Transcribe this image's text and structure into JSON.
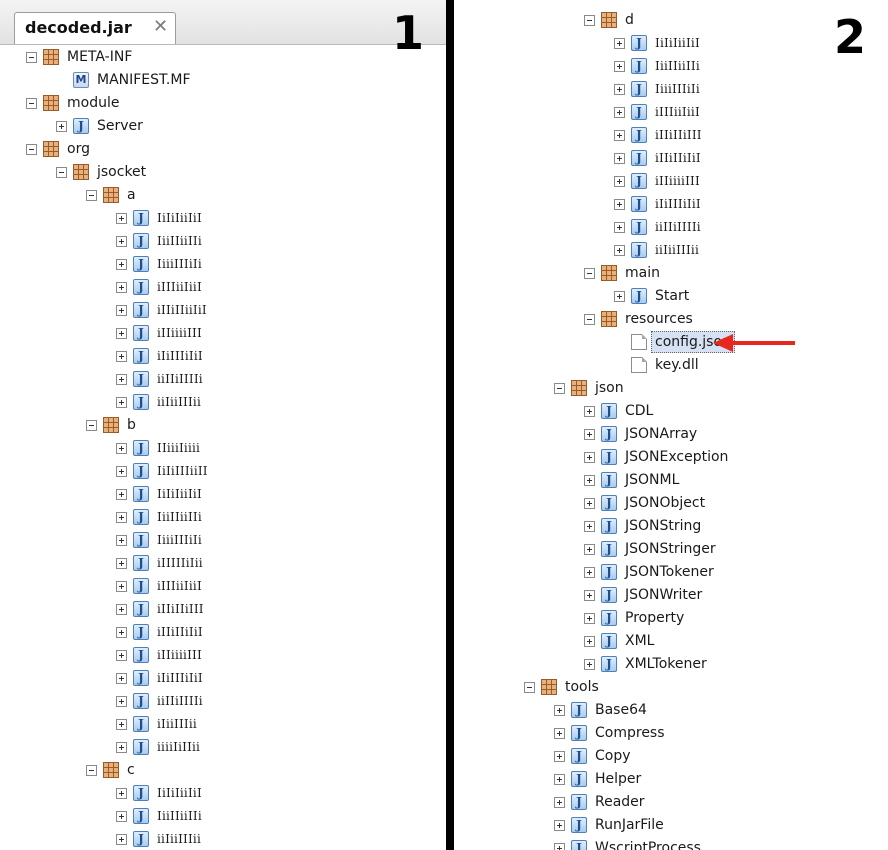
{
  "panel1": {
    "tab_label": "decoded.jar",
    "close_glyph": "✕",
    "number": "1",
    "rows": [
      {
        "indent": 1,
        "toggle": "minus",
        "icon": "package",
        "label": "META-INF"
      },
      {
        "indent": 2,
        "toggle": "none",
        "icon": "manifest",
        "label": "MANIFEST.MF"
      },
      {
        "indent": 1,
        "toggle": "minus",
        "icon": "package",
        "label": "module"
      },
      {
        "indent": 2,
        "toggle": "plus",
        "icon": "class",
        "label": "Server"
      },
      {
        "indent": 1,
        "toggle": "minus",
        "icon": "package",
        "label": "org"
      },
      {
        "indent": 2,
        "toggle": "minus",
        "icon": "package",
        "label": "jsocket"
      },
      {
        "indent": 3,
        "toggle": "minus",
        "icon": "package",
        "label": "a"
      },
      {
        "indent": 4,
        "toggle": "plus",
        "icon": "class",
        "label": "IiIiIiiIiI",
        "obf": true
      },
      {
        "indent": 4,
        "toggle": "plus",
        "icon": "class",
        "label": "IiiIIiiIIi",
        "obf": true
      },
      {
        "indent": 4,
        "toggle": "plus",
        "icon": "class",
        "label": "IiiiIIIiIi",
        "obf": true
      },
      {
        "indent": 4,
        "toggle": "plus",
        "icon": "class",
        "label": "iIIIiiIiiI",
        "obf": true
      },
      {
        "indent": 4,
        "toggle": "plus",
        "icon": "class",
        "label": "iIIiIIiiIiI",
        "obf": true
      },
      {
        "indent": 4,
        "toggle": "plus",
        "icon": "class",
        "label": "iIIiiiiIII",
        "obf": true
      },
      {
        "indent": 4,
        "toggle": "plus",
        "icon": "class",
        "label": "iIiIIIiIiI",
        "obf": true
      },
      {
        "indent": 4,
        "toggle": "plus",
        "icon": "class",
        "label": "iiIIiIIIIi",
        "obf": true
      },
      {
        "indent": 4,
        "toggle": "plus",
        "icon": "class",
        "label": "iiIiiIIIii",
        "obf": true
      },
      {
        "indent": 3,
        "toggle": "minus",
        "icon": "package",
        "label": "b"
      },
      {
        "indent": 4,
        "toggle": "plus",
        "icon": "class",
        "label": "IIiiiIiiii",
        "obf": true
      },
      {
        "indent": 4,
        "toggle": "plus",
        "icon": "class",
        "label": "IiIiIIIiiII",
        "obf": true
      },
      {
        "indent": 4,
        "toggle": "plus",
        "icon": "class",
        "label": "IiIiIiiIiI",
        "obf": true
      },
      {
        "indent": 4,
        "toggle": "plus",
        "icon": "class",
        "label": "IiiIIiiIIi",
        "obf": true
      },
      {
        "indent": 4,
        "toggle": "plus",
        "icon": "class",
        "label": "IiiiIIIiIi",
        "obf": true
      },
      {
        "indent": 4,
        "toggle": "plus",
        "icon": "class",
        "label": "iIIIIIiIii",
        "obf": true
      },
      {
        "indent": 4,
        "toggle": "plus",
        "icon": "class",
        "label": "iIIIiiIiiI",
        "obf": true
      },
      {
        "indent": 4,
        "toggle": "plus",
        "icon": "class",
        "label": "iIIiIIiIII",
        "obf": true
      },
      {
        "indent": 4,
        "toggle": "plus",
        "icon": "class",
        "label": "iIIiIIiIiI",
        "obf": true
      },
      {
        "indent": 4,
        "toggle": "plus",
        "icon": "class",
        "label": "iIIiiiiIII",
        "obf": true
      },
      {
        "indent": 4,
        "toggle": "plus",
        "icon": "class",
        "label": "iIiIIIiIiI",
        "obf": true
      },
      {
        "indent": 4,
        "toggle": "plus",
        "icon": "class",
        "label": "iiIIiIIIIi",
        "obf": true
      },
      {
        "indent": 4,
        "toggle": "plus",
        "icon": "class",
        "label": "iIiiIIIii",
        "obf": true
      },
      {
        "indent": 4,
        "toggle": "plus",
        "icon": "class",
        "label": "iiiiIiIIii",
        "obf": true
      },
      {
        "indent": 3,
        "toggle": "minus",
        "icon": "package",
        "label": "c"
      },
      {
        "indent": 4,
        "toggle": "plus",
        "icon": "class",
        "label": "IiIiIiiIiI",
        "obf": true
      },
      {
        "indent": 4,
        "toggle": "plus",
        "icon": "class",
        "label": "IiiIIiiIIi",
        "obf": true
      },
      {
        "indent": 4,
        "toggle": "plus",
        "icon": "class",
        "label": "iiIiiIIIii",
        "obf": true
      }
    ]
  },
  "panel2": {
    "number": "2",
    "rows": [
      {
        "indent": 3,
        "toggle": "minus",
        "icon": "package",
        "label": "d"
      },
      {
        "indent": 4,
        "toggle": "plus",
        "icon": "class",
        "label": "IiIiIiiIiI",
        "obf": true
      },
      {
        "indent": 4,
        "toggle": "plus",
        "icon": "class",
        "label": "IiiIIiiIIi",
        "obf": true
      },
      {
        "indent": 4,
        "toggle": "plus",
        "icon": "class",
        "label": "IiiiIIIiIi",
        "obf": true
      },
      {
        "indent": 4,
        "toggle": "plus",
        "icon": "class",
        "label": "iIIIiiIiiI",
        "obf": true
      },
      {
        "indent": 4,
        "toggle": "plus",
        "icon": "class",
        "label": "iIIiIIiIII",
        "obf": true
      },
      {
        "indent": 4,
        "toggle": "plus",
        "icon": "class",
        "label": "iIIiIIiIiI",
        "obf": true
      },
      {
        "indent": 4,
        "toggle": "plus",
        "icon": "class",
        "label": "iIIiiiiIII",
        "obf": true
      },
      {
        "indent": 4,
        "toggle": "plus",
        "icon": "class",
        "label": "iIiIIIiIiI",
        "obf": true
      },
      {
        "indent": 4,
        "toggle": "plus",
        "icon": "class",
        "label": "iiIIiIIIIi",
        "obf": true
      },
      {
        "indent": 4,
        "toggle": "plus",
        "icon": "class",
        "label": "iiIiiIIIii",
        "obf": true
      },
      {
        "indent": 3,
        "toggle": "minus",
        "icon": "package",
        "label": "main"
      },
      {
        "indent": 4,
        "toggle": "plus",
        "icon": "class",
        "label": "Start"
      },
      {
        "indent": 3,
        "toggle": "minus",
        "icon": "package",
        "label": "resources"
      },
      {
        "indent": 4,
        "toggle": "none",
        "icon": "file",
        "label": "config.json",
        "selected": true
      },
      {
        "indent": 4,
        "toggle": "none",
        "icon": "file",
        "label": "key.dll"
      },
      {
        "indent": 2,
        "toggle": "minus",
        "icon": "package",
        "label": "json"
      },
      {
        "indent": 3,
        "toggle": "plus",
        "icon": "class",
        "label": "CDL"
      },
      {
        "indent": 3,
        "toggle": "plus",
        "icon": "class",
        "label": "JSONArray"
      },
      {
        "indent": 3,
        "toggle": "plus",
        "icon": "class",
        "label": "JSONException"
      },
      {
        "indent": 3,
        "toggle": "plus",
        "icon": "class",
        "label": "JSONML"
      },
      {
        "indent": 3,
        "toggle": "plus",
        "icon": "class",
        "label": "JSONObject"
      },
      {
        "indent": 3,
        "toggle": "plus",
        "icon": "class",
        "label": "JSONString"
      },
      {
        "indent": 3,
        "toggle": "plus",
        "icon": "class",
        "label": "JSONStringer"
      },
      {
        "indent": 3,
        "toggle": "plus",
        "icon": "class",
        "label": "JSONTokener"
      },
      {
        "indent": 3,
        "toggle": "plus",
        "icon": "class",
        "label": "JSONWriter"
      },
      {
        "indent": 3,
        "toggle": "plus",
        "icon": "class",
        "label": "Property"
      },
      {
        "indent": 3,
        "toggle": "plus",
        "icon": "class",
        "label": "XML"
      },
      {
        "indent": 3,
        "toggle": "plus",
        "icon": "class",
        "label": "XMLTokener"
      },
      {
        "indent": 1,
        "toggle": "minus",
        "icon": "package",
        "label": "tools"
      },
      {
        "indent": 2,
        "toggle": "plus",
        "icon": "class",
        "label": "Base64"
      },
      {
        "indent": 2,
        "toggle": "plus",
        "icon": "class",
        "label": "Compress"
      },
      {
        "indent": 2,
        "toggle": "plus",
        "icon": "class",
        "label": "Copy"
      },
      {
        "indent": 2,
        "toggle": "plus",
        "icon": "class",
        "label": "Helper"
      },
      {
        "indent": 2,
        "toggle": "plus",
        "icon": "class",
        "label": "Reader"
      },
      {
        "indent": 2,
        "toggle": "plus",
        "icon": "class",
        "label": "RunJarFile"
      },
      {
        "indent": 2,
        "toggle": "plus",
        "icon": "class",
        "label": "WscriptProcess"
      }
    ]
  },
  "annotation": {
    "arrow_color": "#e8281e",
    "arrow_icon": "red-arrow-left"
  },
  "colors": {
    "divider": "#000000",
    "selection_bg": "#d6e2f3",
    "package_icon": "#e8b07a"
  }
}
